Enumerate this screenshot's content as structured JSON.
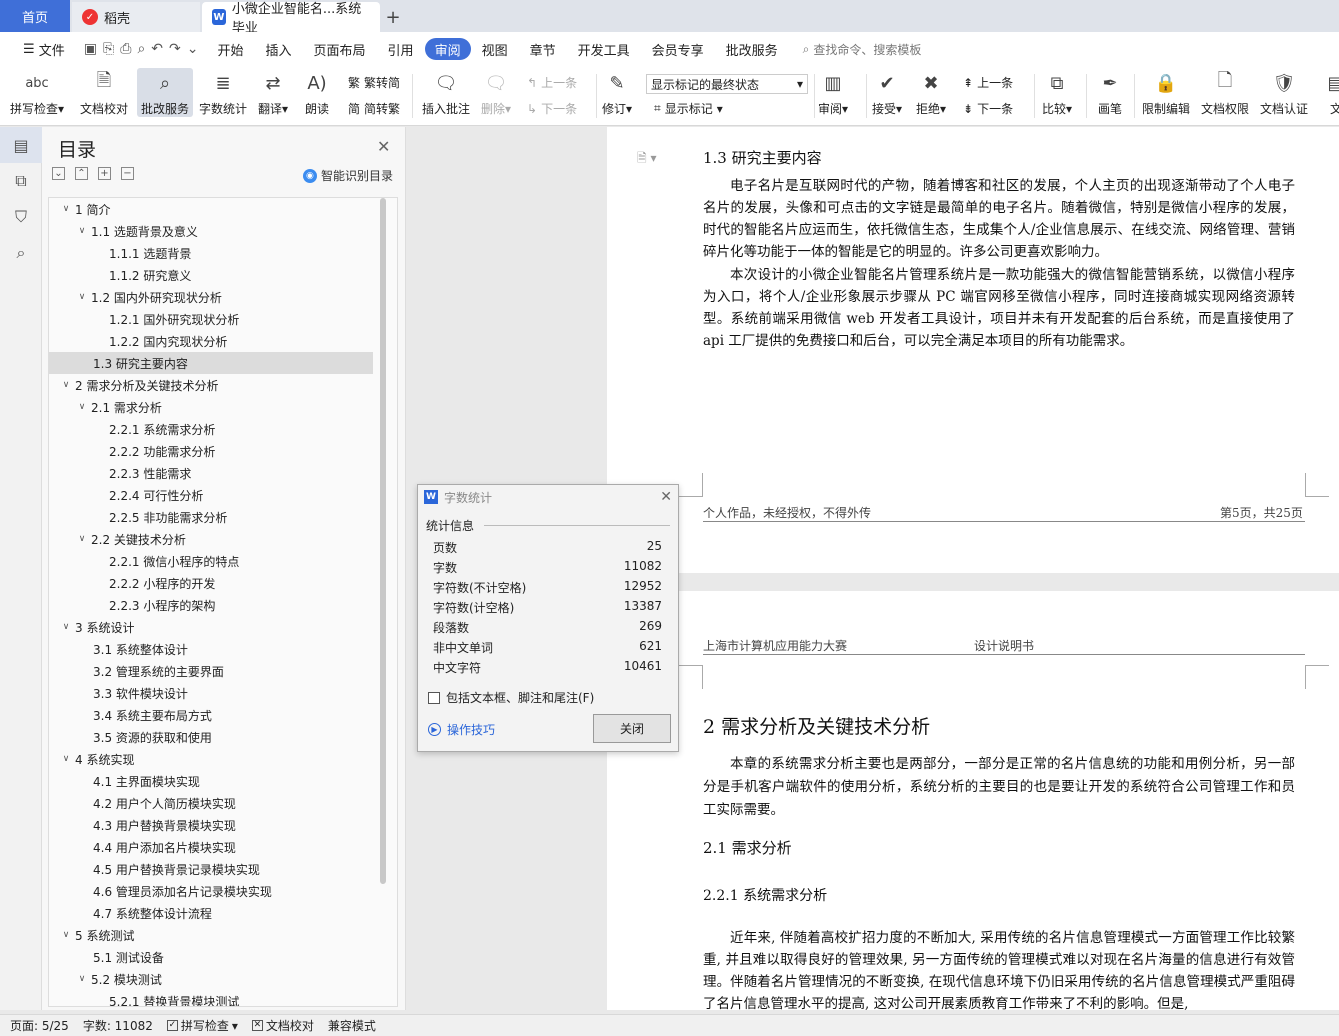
{
  "tabs": {
    "home": "首页",
    "daoke": "稻壳",
    "doc": "小微企业智能名...系统 毕业",
    "add": "+"
  },
  "menubar": {
    "file": "文件",
    "items": [
      "开始",
      "插入",
      "页面布局",
      "引用",
      "审阅",
      "视图",
      "章节",
      "开发工具",
      "会员专享",
      "批改服务"
    ],
    "active": "审阅",
    "search": "查找命令、搜索模板"
  },
  "ribbon": {
    "spell": "拼写检查",
    "proof": "文档校对",
    "correction": "批改服务",
    "wordcount": "字数统计",
    "translate": "翻译",
    "read": "朗读",
    "to_trad": "繁转简",
    "to_simp": "简转繁",
    "insert_comment": "插入批注",
    "delete": "删除",
    "prev": "上一条",
    "next": "下一条",
    "revise": "修订",
    "markup_state": "显示标记的最终状态",
    "show_markup": "显示标记",
    "review": "审阅",
    "accept": "接受",
    "reject": "拒绝",
    "prev2": "上一条",
    "next2": "下一条",
    "compare": "比较",
    "pen": "画笔",
    "restrict": "限制编辑",
    "permission": "文档权限",
    "certify": "文档认证",
    "more": "文"
  },
  "toc": {
    "title": "目录",
    "smart": "智能识别目录",
    "items": [
      {
        "level": 1,
        "text": "1  简介",
        "arrow": "∨"
      },
      {
        "level": 2,
        "text": "1.1  选题背景及意义",
        "arrow": "∨"
      },
      {
        "level": 3,
        "text": "1.1.1  选题背景",
        "arrow": ""
      },
      {
        "level": 3,
        "text": "1.1.2  研究意义",
        "arrow": ""
      },
      {
        "level": 2,
        "text": "1.2 国内外研究现状分析",
        "arrow": "∨"
      },
      {
        "level": 3,
        "text": "1.2.1 国外研究现状分析",
        "arrow": ""
      },
      {
        "level": 3,
        "text": "1.2.2 国内究现状分析",
        "arrow": ""
      },
      {
        "level": 2,
        "text": "1.3  研究主要内容",
        "arrow": "",
        "selected": true
      },
      {
        "level": 1,
        "text": "2  需求分析及关键技术分析",
        "arrow": "∨"
      },
      {
        "level": 2,
        "text": "2.1 需求分析",
        "arrow": "∨"
      },
      {
        "level": 3,
        "text": "2.2.1 系统需求分析",
        "arrow": ""
      },
      {
        "level": 3,
        "text": "2.2.2 功能需求分析",
        "arrow": ""
      },
      {
        "level": 3,
        "text": "2.2.3 性能需求",
        "arrow": ""
      },
      {
        "level": 3,
        "text": "2.2.4 可行性分析",
        "arrow": ""
      },
      {
        "level": 3,
        "text": "2.2.5 非功能需求分析",
        "arrow": ""
      },
      {
        "level": 2,
        "text": "2.2 关键技术分析",
        "arrow": "∨"
      },
      {
        "level": 3,
        "text": "2.2.1 微信小程序的特点",
        "arrow": ""
      },
      {
        "level": 3,
        "text": "2.2.2 小程序的开发",
        "arrow": ""
      },
      {
        "level": 3,
        "text": "2.2.3 小程序的架构",
        "arrow": ""
      },
      {
        "level": 1,
        "text": "3  系统设计",
        "arrow": "∨"
      },
      {
        "level": 2,
        "text": "3.1 系统整体设计",
        "arrow": ""
      },
      {
        "level": 2,
        "text": "3.2 管理系统的主要界面",
        "arrow": ""
      },
      {
        "level": 2,
        "text": "3.3 软件模块设计",
        "arrow": ""
      },
      {
        "level": 2,
        "text": "3.4 系统主要布局方式",
        "arrow": ""
      },
      {
        "level": 2,
        "text": "3.5 资源的获取和使用",
        "arrow": ""
      },
      {
        "level": 1,
        "text": "4  系统实现",
        "arrow": "∨"
      },
      {
        "level": 2,
        "text": "4.1 主界面模块实现",
        "arrow": ""
      },
      {
        "level": 2,
        "text": "4.2 用户个人简历模块实现",
        "arrow": ""
      },
      {
        "level": 2,
        "text": "4.3 用户替换背景模块实现",
        "arrow": ""
      },
      {
        "level": 2,
        "text": "4.4 用户添加名片模块实现",
        "arrow": ""
      },
      {
        "level": 2,
        "text": "4.5 用户替换背景记录模块实现",
        "arrow": ""
      },
      {
        "level": 2,
        "text": "4.6 管理员添加名片记录模块实现",
        "arrow": ""
      },
      {
        "level": 2,
        "text": "4.7 系统整体设计流程",
        "arrow": ""
      },
      {
        "level": 1,
        "text": "5  系统测试",
        "arrow": "∨"
      },
      {
        "level": 2,
        "text": "5.1  测试设备",
        "arrow": ""
      },
      {
        "level": 2,
        "text": "5.2  模块测试",
        "arrow": "∨"
      },
      {
        "level": 3,
        "text": "5.2.1 替换背景模块测试",
        "arrow": ""
      }
    ]
  },
  "page1": {
    "heading": "1.3  研究主要内容",
    "p1": "电子名片是互联网时代的产物，随着博客和社区的发展，个人主页的出现逐渐带动了个人电子名片的发展，头像和可点击的文字链是最简单的电子名片。随着微信，特别是微信小程序的发展，时代的智能名片应运而生，依托微信生态，生成集个人/企业信息展示、在线交流、网络管理、营销碎片化等功能于一体的智能是它的明显的。许多公司更喜欢影响力。",
    "p2": "本次设计的小微企业智能名片管理系统片是一款功能强大的微信智能营销系统，以微信小程序为入口，将个人/企业形象展示步骤从 PC 端官网移至微信小程序，同时连接商城实现网络资源转型。系统前端采用微信 web 开发者工具设计，项目并未有开发配套的后台系统，而是直接使用了 api 工厂提供的免费接口和后台，可以完全满足本项目的所有功能需求。",
    "footer_left": "个人作品，未经授权，不得外传",
    "footer_right": "第5页，共25页"
  },
  "page2": {
    "header_left": "上海市计算机应用能力大赛",
    "header_mid": "设计说明书",
    "h1": "2  需求分析及关键技术分析",
    "p1": "本章的系统需求分析主要也是两部分，一部分是正常的名片信息统的功能和用例分析，另一部分是手机客户端软件的使用分析，系统分析的主要目的也是要让开发的系统符合公司管理工作和员工实际需要。",
    "h2": "2.1 需求分析",
    "h3": "2.2.1 系统需求分析",
    "p2": "近年来, 伴随着高校扩招力度的不断加大, 采用传统的名片信息管理模式一方面管理工作比较繁重, 并且难以取得良好的管理效果, 另一方面传统的管理模式难以对现在名片海量的信息进行有效管理。伴随着名片管理情况的不断变换, 在现代信息环境下仍旧采用传统的名片信息管理模式严重阻碍了名片信息管理水平的提高, 这对公司开展素质教育工作带来了不利的影响。但是,"
  },
  "dialog": {
    "title": "字数统计",
    "section": "统计信息",
    "rows": [
      {
        "label": "页数",
        "value": "25"
      },
      {
        "label": "字数",
        "value": "11082"
      },
      {
        "label": "字符数(不计空格)",
        "value": "12952"
      },
      {
        "label": "字符数(计空格)",
        "value": "13387"
      },
      {
        "label": "段落数",
        "value": "269"
      },
      {
        "label": "非中文单词",
        "value": "621"
      },
      {
        "label": "中文字符",
        "value": "10461"
      }
    ],
    "checkbox": "包括文本框、脚注和尾注(F)",
    "tips": "操作技巧",
    "close": "关闭"
  },
  "status": {
    "page": "页面: 5/25",
    "words": "字数: 11082",
    "spell": "拼写检查",
    "proof": "文档校对",
    "compat": "兼容模式"
  }
}
